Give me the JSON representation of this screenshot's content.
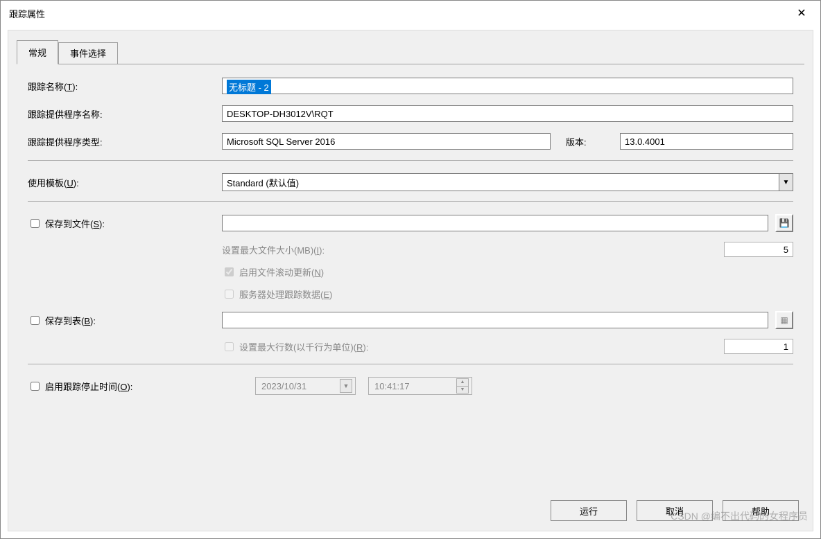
{
  "window": {
    "title": "跟踪属性"
  },
  "tabs": {
    "general": "常规",
    "events": "事件选择"
  },
  "labels": {
    "trace_name": "跟踪名称(T):",
    "provider_name": "跟踪提供程序名称:",
    "provider_type": "跟踪提供程序类型:",
    "version": "版本:",
    "use_template": "使用模板(U):",
    "save_to_file": "保存到文件(S):",
    "max_file_size": "设置最大文件大小(MB)(I):",
    "enable_rollover": "启用文件滚动更新(N)",
    "server_processes": "服务器处理跟踪数据(E)",
    "save_to_table": "保存到表(B):",
    "max_rows": "设置最大行数(以千行为单位)(R):",
    "enable_stop_time": "启用跟踪停止时间(O):"
  },
  "values": {
    "trace_name": "无标题 - 2",
    "provider_name": "DESKTOP-DH3012V\\RQT",
    "provider_type": "Microsoft SQL Server 2016",
    "version": "13.0.4001",
    "template": "Standard (默认值)",
    "max_file_size": "5",
    "max_rows": "1",
    "stop_date": "2023/10/31",
    "stop_time": "10:41:17"
  },
  "buttons": {
    "run": "运行",
    "cancel": "取消",
    "help": "帮助"
  },
  "watermark": "CSDN @编不出代码的女程序员"
}
